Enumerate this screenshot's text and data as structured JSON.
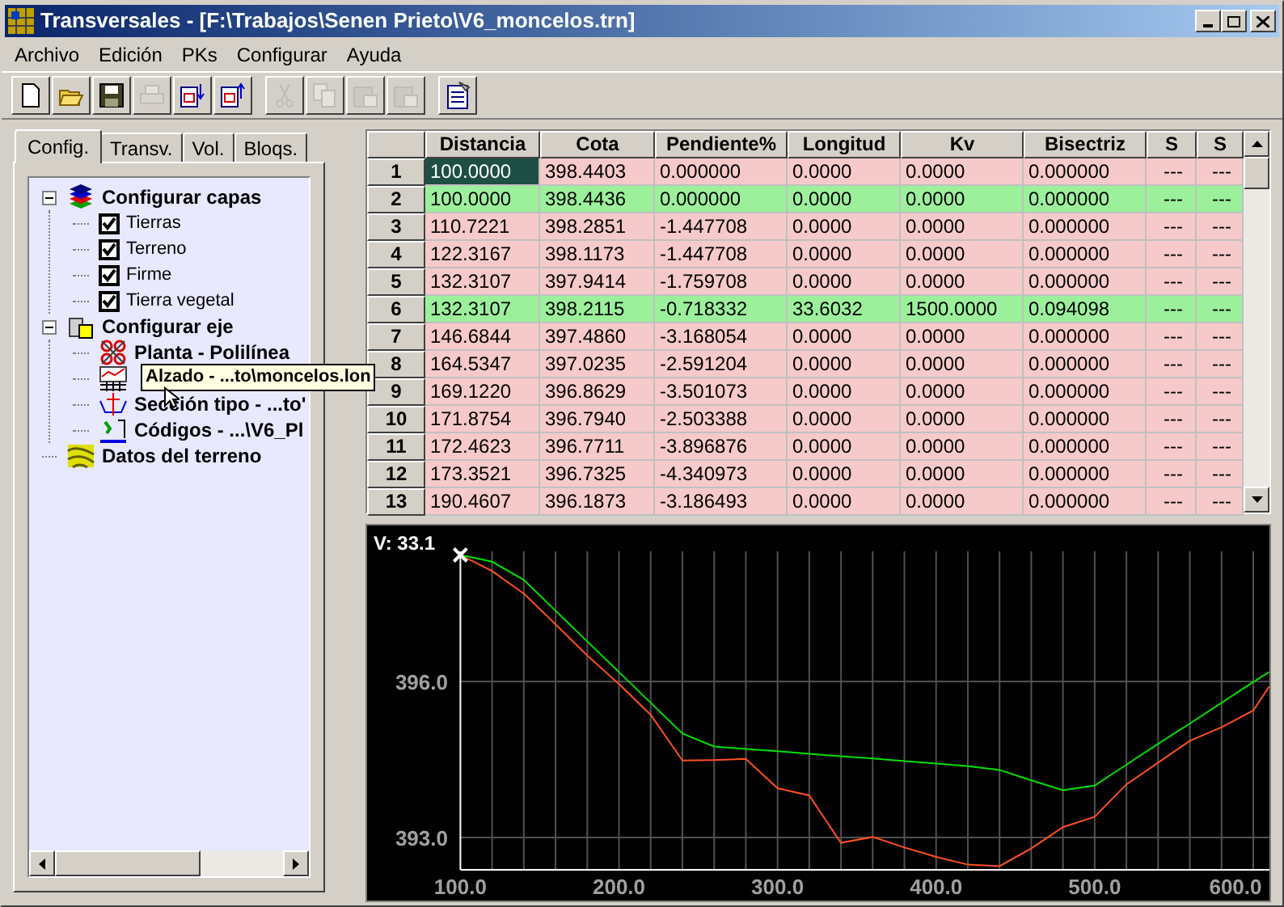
{
  "window": {
    "title": "Transversales - [F:\\Trabajos\\Senen Prieto\\V6_moncelos.trn]"
  },
  "menu": [
    "Archivo",
    "Edición",
    "PKs",
    "Configurar",
    "Ayuda"
  ],
  "toolbar": {
    "groups": [
      {
        "buttons": [
          {
            "kind": "new",
            "disabled": false
          },
          {
            "kind": "open",
            "disabled": false
          },
          {
            "kind": "save",
            "disabled": false
          },
          {
            "kind": "print",
            "disabled": true
          },
          {
            "kind": "export-down",
            "disabled": false
          },
          {
            "kind": "export-up",
            "disabled": false
          }
        ]
      },
      {
        "buttons": [
          {
            "kind": "cut",
            "disabled": true
          },
          {
            "kind": "copy",
            "disabled": true
          },
          {
            "kind": "paste",
            "disabled": true
          },
          {
            "kind": "paste-special",
            "disabled": true
          }
        ]
      },
      {
        "buttons": [
          {
            "kind": "properties",
            "disabled": false
          }
        ]
      }
    ]
  },
  "tabs": [
    {
      "label": "Config.",
      "selected": true
    },
    {
      "label": "Transv.",
      "selected": false
    },
    {
      "label": "Vol.",
      "selected": false
    },
    {
      "label": "Bloqs.",
      "selected": false
    }
  ],
  "tree": [
    {
      "kind": "layers",
      "label": "Configurar capas",
      "expanded": true,
      "children": [
        {
          "kind": "check",
          "label": "Tierras",
          "checked": true
        },
        {
          "kind": "check",
          "label": "Terreno",
          "checked": true
        },
        {
          "kind": "check",
          "label": "Firme",
          "checked": true
        },
        {
          "kind": "check",
          "label": "Tierra vegetal",
          "checked": true
        }
      ]
    },
    {
      "kind": "axis",
      "label": "Configurar eje",
      "expanded": true,
      "children": [
        {
          "kind": "plan",
          "label": "Planta - Polilínea"
        },
        {
          "kind": "elevation",
          "tooltip": "Alzado - ...to\\moncelos.lon"
        },
        {
          "kind": "section",
          "label": "Sección tipo - ...to'"
        },
        {
          "kind": "codes",
          "label": "Códigos - ...\\V6_Pl"
        }
      ]
    },
    {
      "kind": "terrain",
      "label": "Datos del terreno"
    }
  ],
  "table": {
    "columns": [
      "Distancia",
      "Cota",
      "Pendiente%",
      "Longitud",
      "Kv",
      "Bisectriz",
      "S",
      "S"
    ],
    "rows": [
      {
        "header": "1",
        "kind": "point",
        "selected": true,
        "cells": [
          "100.0000",
          "398.4403",
          "0.000000",
          "0.0000",
          "0.0000",
          "0.000000",
          "---",
          "---"
        ]
      },
      {
        "header": "2",
        "kind": "vertex",
        "selected": false,
        "cells": [
          "100.0000",
          "398.4436",
          "0.000000",
          "0.0000",
          "0.0000",
          "0.000000",
          "---",
          "---"
        ]
      },
      {
        "header": "3",
        "kind": "point",
        "selected": false,
        "cells": [
          "110.7221",
          "398.2851",
          "-1.447708",
          "0.0000",
          "0.0000",
          "0.000000",
          "---",
          "---"
        ]
      },
      {
        "header": "4",
        "kind": "point",
        "selected": false,
        "cells": [
          "122.3167",
          "398.1173",
          "-1.447708",
          "0.0000",
          "0.0000",
          "0.000000",
          "---",
          "---"
        ]
      },
      {
        "header": "5",
        "kind": "point",
        "selected": false,
        "cells": [
          "132.3107",
          "397.9414",
          "-1.759708",
          "0.0000",
          "0.0000",
          "0.000000",
          "---",
          "---"
        ]
      },
      {
        "header": "6",
        "kind": "vertex",
        "selected": false,
        "cells": [
          "132.3107",
          "398.2115",
          "-0.718332",
          "33.6032",
          "1500.0000",
          "0.094098",
          "---",
          "---"
        ]
      },
      {
        "header": "7",
        "kind": "point",
        "selected": false,
        "cells": [
          "146.6844",
          "397.4860",
          "-3.168054",
          "0.0000",
          "0.0000",
          "0.000000",
          "---",
          "---"
        ]
      },
      {
        "header": "8",
        "kind": "point",
        "selected": false,
        "cells": [
          "164.5347",
          "397.0235",
          "-2.591204",
          "0.0000",
          "0.0000",
          "0.000000",
          "---",
          "---"
        ]
      },
      {
        "header": "9",
        "kind": "point",
        "selected": false,
        "cells": [
          "169.1220",
          "396.8629",
          "-3.501073",
          "0.0000",
          "0.0000",
          "0.000000",
          "---",
          "---"
        ]
      },
      {
        "header": "10",
        "kind": "point",
        "selected": false,
        "cells": [
          "171.8754",
          "396.7940",
          "-2.503388",
          "0.0000",
          "0.0000",
          "0.000000",
          "---",
          "---"
        ]
      },
      {
        "header": "11",
        "kind": "point",
        "selected": false,
        "cells": [
          "172.4623",
          "396.7711",
          "-3.896876",
          "0.0000",
          "0.0000",
          "0.000000",
          "---",
          "---"
        ]
      },
      {
        "header": "12",
        "kind": "point",
        "selected": false,
        "cells": [
          "173.3521",
          "396.7325",
          "-4.340973",
          "0.0000",
          "0.0000",
          "0.000000",
          "---",
          "---"
        ]
      },
      {
        "header": "13",
        "kind": "point",
        "selected": false,
        "cells": [
          "190.4607",
          "396.1873",
          "-3.186493",
          "0.0000",
          "0.0000",
          "0.000000",
          "---",
          "---"
        ]
      }
    ]
  },
  "profile": {
    "readout": "V: 33.1",
    "chart_data": {
      "type": "line",
      "x": [
        100,
        120,
        140,
        160,
        180,
        200,
        220,
        240,
        260,
        280,
        300,
        320,
        340,
        360,
        380,
        400,
        420,
        440,
        460,
        480,
        500,
        520,
        540,
        560,
        580,
        600,
        610
      ],
      "series": [
        {
          "color": "#00e000",
          "values": [
            398.43,
            398.3,
            397.95,
            397.36,
            396.77,
            396.18,
            395.59,
            395.0,
            394.75,
            394.7,
            394.66,
            394.61,
            394.56,
            394.52,
            394.47,
            394.42,
            394.37,
            394.3,
            394.1,
            393.91,
            394.0,
            394.4,
            394.8,
            395.19,
            395.59,
            395.99,
            396.18
          ]
        },
        {
          "color": "#ff5020",
          "values": [
            398.43,
            398.12,
            397.69,
            397.1,
            396.5,
            395.95,
            395.36,
            394.48,
            394.49,
            394.51,
            393.95,
            393.81,
            392.9,
            393.01,
            392.81,
            392.63,
            392.48,
            392.45,
            392.79,
            393.2,
            393.4,
            394.02,
            394.44,
            394.86,
            395.12,
            395.44,
            395.9
          ]
        }
      ],
      "grid": true,
      "xlim": [
        100,
        615
      ],
      "ylim": [
        392.38,
        398.5
      ],
      "xticks": [
        {
          "value": 100,
          "label": "100.0"
        },
        {
          "value": 200,
          "label": "200.0"
        },
        {
          "value": 300,
          "label": "300.0"
        },
        {
          "value": 400,
          "label": "400.0"
        },
        {
          "value": 500,
          "label": "500.0"
        },
        {
          "value": 600,
          "label": "600.0"
        }
      ],
      "yticks": [
        {
          "value": 393,
          "label": "393.0"
        },
        {
          "value": 396,
          "label": "396.0"
        }
      ]
    }
  }
}
